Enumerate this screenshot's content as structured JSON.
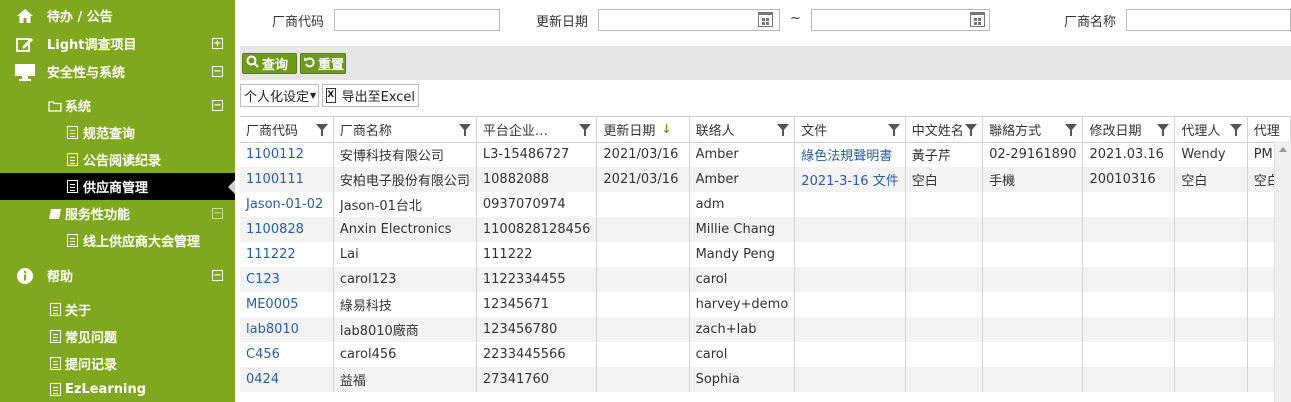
{
  "sidebar": {
    "items": [
      {
        "label": "待办 / 公告",
        "icon": "home-icon",
        "level": 1
      },
      {
        "label": "Light调查项目",
        "icon": "edit-icon",
        "level": 1,
        "toggle": "+"
      },
      {
        "label": "安全性与系统",
        "icon": "monitor-icon",
        "level": 1,
        "toggle": "−"
      },
      {
        "label": "系统",
        "icon": "folder-icon",
        "level": 2,
        "toggle": "−"
      },
      {
        "label": "规范查询",
        "icon": "document-icon",
        "level": 3
      },
      {
        "label": "公告阅读纪录",
        "icon": "document-icon",
        "level": 3
      },
      {
        "label": "供应商管理",
        "icon": "document-icon",
        "level": 3,
        "active": true
      },
      {
        "label": "服务性功能",
        "icon": "book-icon",
        "level": 2,
        "toggle": "−"
      },
      {
        "label": "线上供应商大会管理",
        "icon": "document-icon",
        "level": 3
      },
      {
        "label": "帮助",
        "icon": "info-icon",
        "level": 1,
        "toggle": "−"
      },
      {
        "label": "关于",
        "icon": "document-icon",
        "level": 2
      },
      {
        "label": "常见问题",
        "icon": "document-icon",
        "level": 2
      },
      {
        "label": "提问记录",
        "icon": "document-icon",
        "level": 2
      },
      {
        "label": "EzLearning",
        "icon": "document-icon",
        "level": 2
      }
    ]
  },
  "filters": {
    "vendor_code_label": "厂商代码",
    "vendor_code_value": "",
    "update_date_label": "更新日期",
    "date_from": "",
    "date_sep": "~",
    "date_to": "",
    "vendor_name_label": "厂商名称",
    "vendor_name_value": ""
  },
  "toolbar": {
    "query_label": "查询",
    "reset_label": "重置",
    "personalize_label": "个人化设定",
    "export_label": "导出至Excel"
  },
  "grid": {
    "columns": [
      "厂商代码",
      "厂商名称",
      "平台企业代码",
      "更新日期",
      "联络人",
      "文件",
      "中文姓名",
      "聯絡方式",
      "修改日期",
      "代理人",
      "代理"
    ],
    "sort_indicator": "↓",
    "rows": [
      [
        "1100112",
        "安博科技有限公司",
        "L3-15486727",
        "2021/03/16",
        "Amber",
        "綠色法規聲明書",
        "黃子芹",
        "02-29161890",
        "2021.03.16",
        "Wendy",
        "PM"
      ],
      [
        "1100111",
        "安柏电子股份有限公司",
        "10882088",
        "2021/03/16",
        "Amber",
        "2021-3-16 文件",
        "空白",
        "手機",
        "20010316",
        "空白",
        "空白"
      ],
      [
        "Jason-01-02",
        "Jason-01台北",
        "0937070974",
        "",
        "adm",
        "",
        "",
        "",
        "",
        "",
        ""
      ],
      [
        "1100828",
        "Anxin Electronics",
        "1100828128456",
        "",
        "Millie Chang",
        "",
        "",
        "",
        "",
        "",
        ""
      ],
      [
        "111222",
        "Lai",
        "111222",
        "",
        "Mandy Peng",
        "",
        "",
        "",
        "",
        "",
        ""
      ],
      [
        "C123",
        "carol123",
        "1122334455",
        "",
        "carol",
        "",
        "",
        "",
        "",
        "",
        ""
      ],
      [
        "ME0005",
        "綠易科技",
        "12345671",
        "",
        "harvey+demo",
        "",
        "",
        "",
        "",
        "",
        ""
      ],
      [
        "lab8010",
        "lab8010廠商",
        "123456780",
        "",
        "zach+lab",
        "",
        "",
        "",
        "",
        "",
        ""
      ],
      [
        "C456",
        "carol456",
        "2233445566",
        "",
        "carol",
        "",
        "",
        "",
        "",
        "",
        ""
      ],
      [
        "0424",
        "益福",
        "27341760",
        "",
        "Sophia",
        "",
        "",
        "",
        "",
        "",
        ""
      ]
    ]
  }
}
